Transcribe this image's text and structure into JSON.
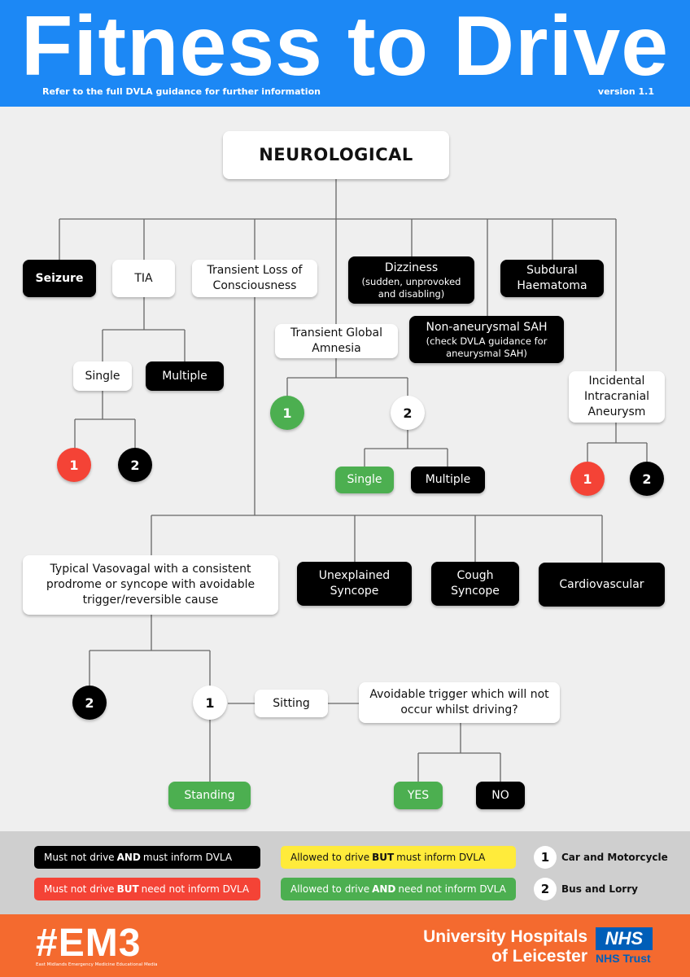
{
  "header": {
    "title": "Fitness to Drive",
    "subtitle": "Refer to the full DVLA guidance for further information",
    "version": "version 1.1"
  },
  "diagram": {
    "root": "NEUROLOGICAL",
    "categories": {
      "seizure": "Seizure",
      "tia": "TIA",
      "tloc": "Transient Loss of Consciousness",
      "tga": "Transient Global Amnesia",
      "dizziness": "Dizziness",
      "dizziness_note": "(sudden, unprovoked and disabling)",
      "nonaneurysmal_sah": "Non-aneurysmal SAH",
      "nonaneurysmal_sah_note": "(check DVLA guidance for aneurysmal SAH)",
      "subdural": "Subdural Haematoma",
      "aneurysm": "Incidental Intracranial Aneurysm"
    },
    "tia_branch": {
      "single": "Single",
      "multiple": "Multiple",
      "group1": "1",
      "group2": "2"
    },
    "tga_branch": {
      "group1": "1",
      "group2": "2",
      "single": "Single",
      "multiple": "Multiple"
    },
    "aneurysm_branch": {
      "group1": "1",
      "group2": "2"
    },
    "tloc_branch": {
      "vasovagal": "Typical Vasovagal with a consistent prodrome or syncope with avoidable trigger/reversible cause",
      "unexplained": "Unexplained Syncope",
      "cough": "Cough Syncope",
      "cardiovascular": "Cardiovascular",
      "group2": "2",
      "group1": "1",
      "sitting": "Sitting",
      "standing": "Standing",
      "question": "Avoidable trigger which will not occur whilst driving?",
      "yes": "YES",
      "no": "NO"
    }
  },
  "legend": {
    "black": {
      "pre": "Must not drive",
      "bold": "AND",
      "post": "must inform DVLA",
      "color": "#000000"
    },
    "red": {
      "pre": "Must not drive",
      "bold": "BUT",
      "post": "need not inform DVLA",
      "color": "#f44336"
    },
    "yellow": {
      "pre": "Allowed to drive",
      "bold": "BUT",
      "post": "must inform DVLA",
      "color": "#ffeb3b"
    },
    "green": {
      "pre": "Allowed to drive",
      "bold": "AND",
      "post": "need not inform DVLA",
      "color": "#4caf50"
    },
    "group1": {
      "num": "1",
      "label": "Car and Motorcycle"
    },
    "group2": {
      "num": "2",
      "label": "Bus and Lorry"
    }
  },
  "footer": {
    "em3": "#EM3",
    "em3_sub": "East Midlands Emergency Medicine Educational Media",
    "org_line1": "University Hospitals",
    "org_line2": "of Leicester",
    "nhs": "NHS",
    "nhs_trust": "NHS Trust"
  }
}
